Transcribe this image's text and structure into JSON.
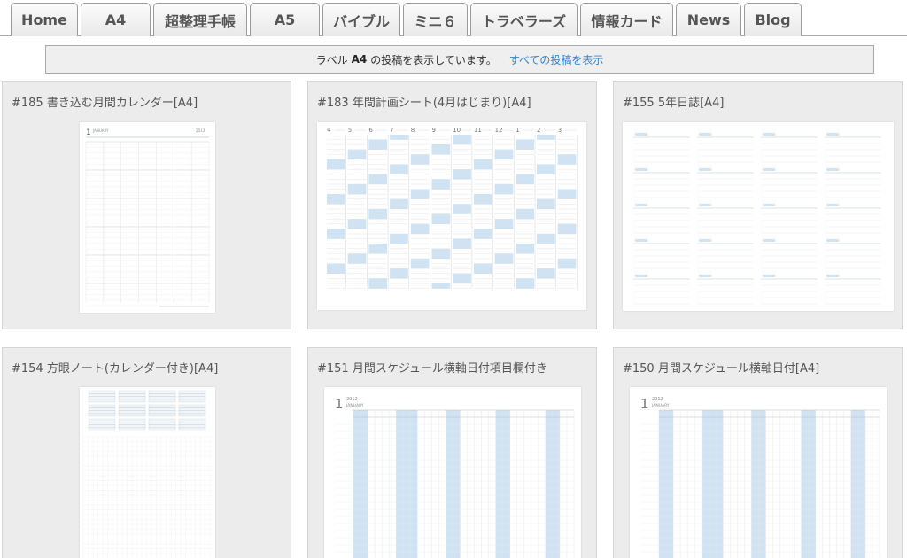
{
  "nav": {
    "tabs": [
      {
        "label": "Home"
      },
      {
        "label": "A4"
      },
      {
        "label": "超整理手帳"
      },
      {
        "label": "A5"
      },
      {
        "label": "バイブル"
      },
      {
        "label": "ミニ６"
      },
      {
        "label": "トラベラーズ"
      },
      {
        "label": "情報カード"
      },
      {
        "label": "News"
      },
      {
        "label": "Blog"
      }
    ]
  },
  "notice": {
    "prefix": "ラベル",
    "label": "A4",
    "suffix": "の投稿を表示しています。",
    "link": "すべての投稿を表示"
  },
  "posts": [
    {
      "title": "#185  書き込む月間カレンダー[A4]",
      "thumb_icon": "monthly-calendar-icon",
      "thumb_month": "1",
      "thumb_month_name": "JANUARY",
      "thumb_year": "2013"
    },
    {
      "title": "#183  年間計画シート(4月はじまり)[A4]",
      "thumb_icon": "yearly-plan-icon",
      "months": [
        "4",
        "5",
        "6",
        "7",
        "8",
        "9",
        "10",
        "11",
        "12",
        "1",
        "2",
        "3"
      ]
    },
    {
      "title": "#155  5年日誌[A4]",
      "thumb_icon": "five-year-diary-icon"
    },
    {
      "title": "#154  方眼ノート(カレンダー付き)[A4]",
      "thumb_icon": "grid-note-icon"
    },
    {
      "title": "#151  月間スケジュール横軸日付項目欄付き",
      "thumb_icon": "monthly-schedule-icon",
      "thumb_month": "1",
      "thumb_year": "2012",
      "thumb_month_name": "JANUARY"
    },
    {
      "title": "#150  月間スケジュール横軸日付[A4]",
      "thumb_icon": "monthly-schedule-icon",
      "thumb_month": "1",
      "thumb_year": "2012",
      "thumb_month_name": "JANUARY"
    }
  ],
  "colors": {
    "accent_blue": "#cfe3f3",
    "link": "#2f86d6"
  }
}
